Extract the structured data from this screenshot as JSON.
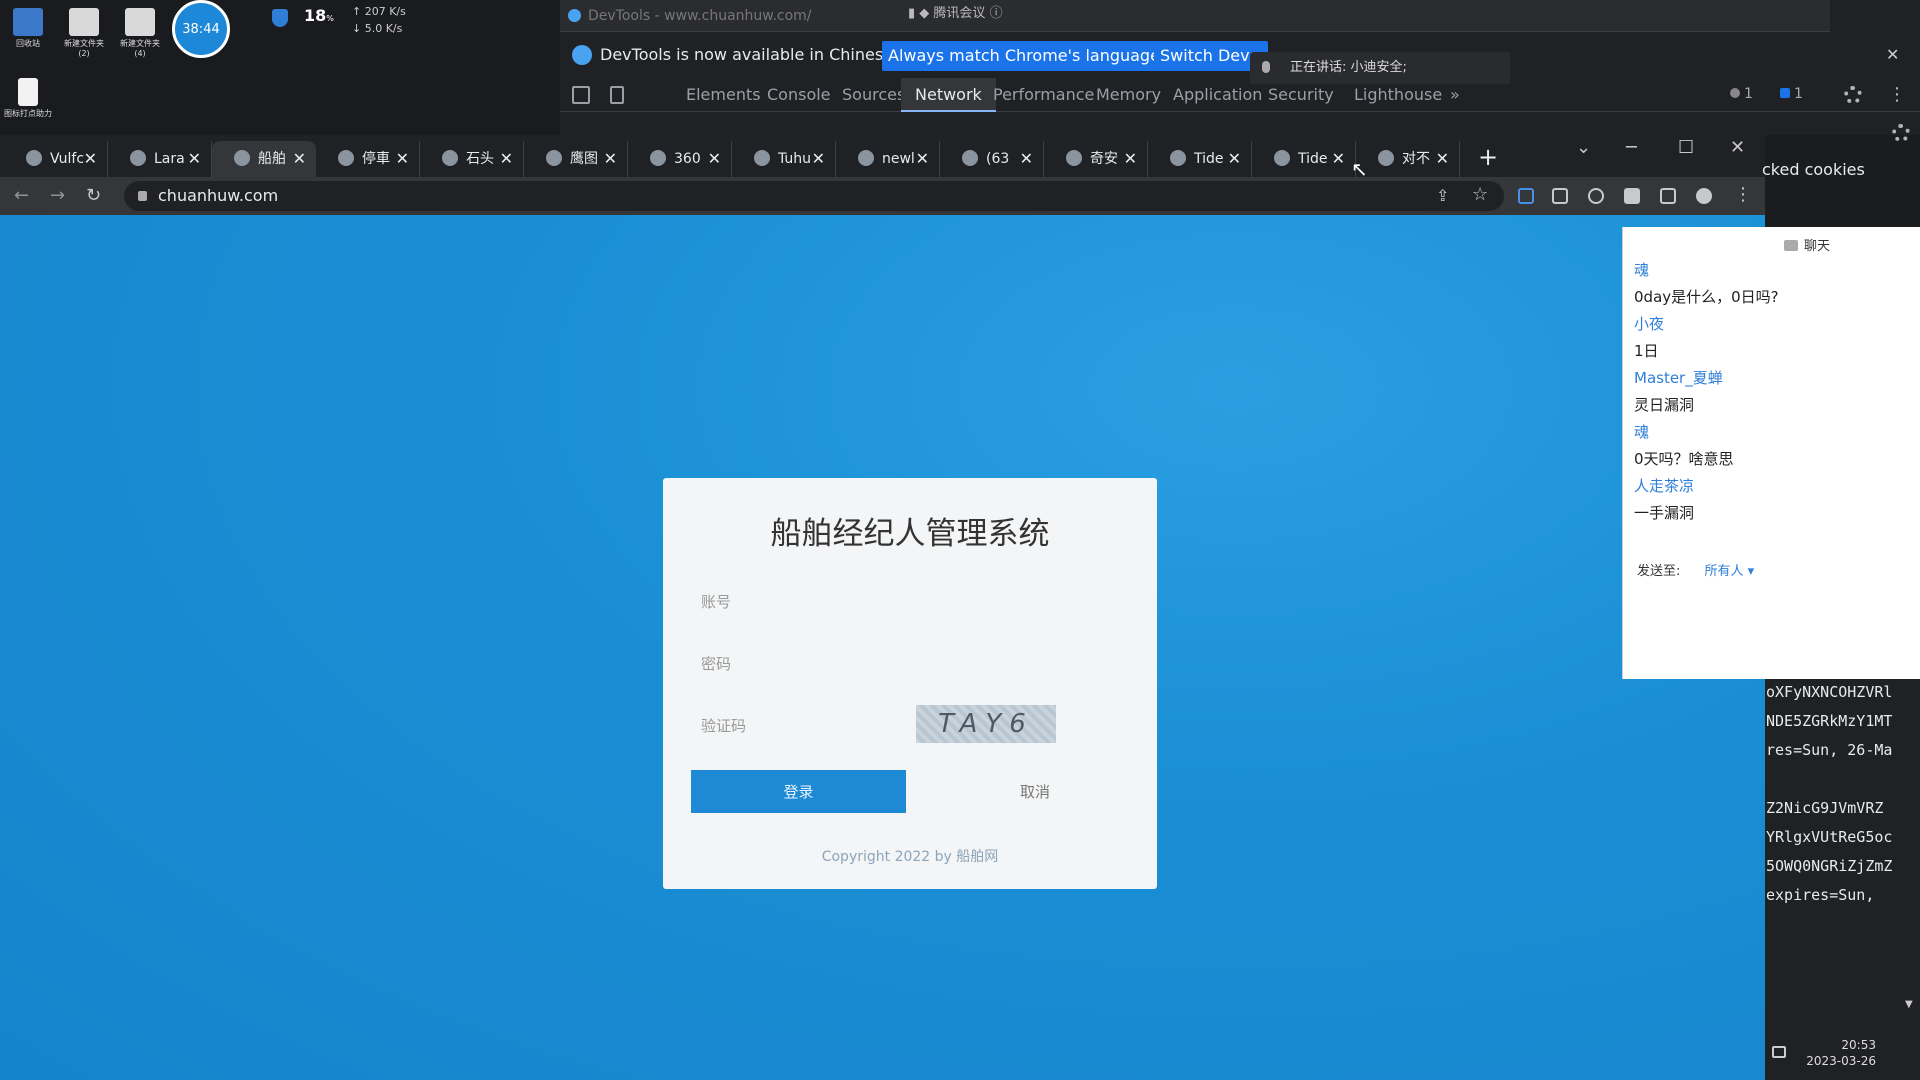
{
  "desktop": {
    "icons": [
      "回收站",
      "新建文件夹\n(2)",
      "新建文件夹\n(4)",
      "图标打点助力"
    ],
    "timer": "38:44",
    "cpu": "18",
    "cpu_unit": "%",
    "net_up": "207",
    "net_down": "5.0",
    "net_unit": "K/s"
  },
  "devtools": {
    "title": "DevTools - www.chuanhuw.com/",
    "meeting": "腾讯会议",
    "info_message": "DevTools is now available in Chinese!",
    "btn_match": "Always match Chrome's language",
    "btn_switch": "Switch Dev",
    "speaking": "正在讲话: 小迪安全;",
    "tabs": [
      "Elements",
      "Console",
      "Sources",
      "Network",
      "Performance",
      "Memory",
      "Application",
      "Security",
      "Lighthouse",
      "»"
    ],
    "active_tab": "Network",
    "errors": "1",
    "messages": "1"
  },
  "chrome": {
    "tabs": [
      "Vulfc",
      "Lara",
      "船舶",
      "停車",
      "石头",
      "鹰图",
      "360",
      "Tuhu",
      "newl",
      "(63",
      "奇安",
      "Tide",
      "Tide",
      "对不"
    ],
    "active_tab_index": 2,
    "url": "chuanhuw.com",
    "blocked_cookies": "cked cookies"
  },
  "login": {
    "title": "船舶经纪人管理系统",
    "account_label": "账号",
    "password_label": "密码",
    "captcha_label": "验证码",
    "captcha_text": "TAY6",
    "login_button": "登录",
    "cancel_button": "取消",
    "copyright": "Copyright 2022 by 船舶网"
  },
  "chat": {
    "title": "聊天",
    "messages": [
      {
        "who": "魂",
        "text": "0day是什么，0日吗?"
      },
      {
        "who": "小夜",
        "text": "1日"
      },
      {
        "who": "Master_夏蝉",
        "text": "灵日漏洞"
      },
      {
        "who": "魂",
        "text": "0天吗？啥意思"
      },
      {
        "who": "人走茶凉",
        "text": "一手漏洞"
      }
    ],
    "send_to_label": "发送至:",
    "send_to_value": "所有人"
  },
  "cookies": [
    "oXFyNXNCOHZVRl",
    "NDE5ZGRkMzY1MT",
    "res=Sun, 26-Ma",
    "",
    "Z2NicG9JVmVRZ",
    "YRlgxVUtReG5oc",
    "5OWQ0NGRiZjZmZ",
    " expires=Sun,"
  ],
  "taskbar": {
    "time": "20:53",
    "date": "2023-03-26"
  }
}
